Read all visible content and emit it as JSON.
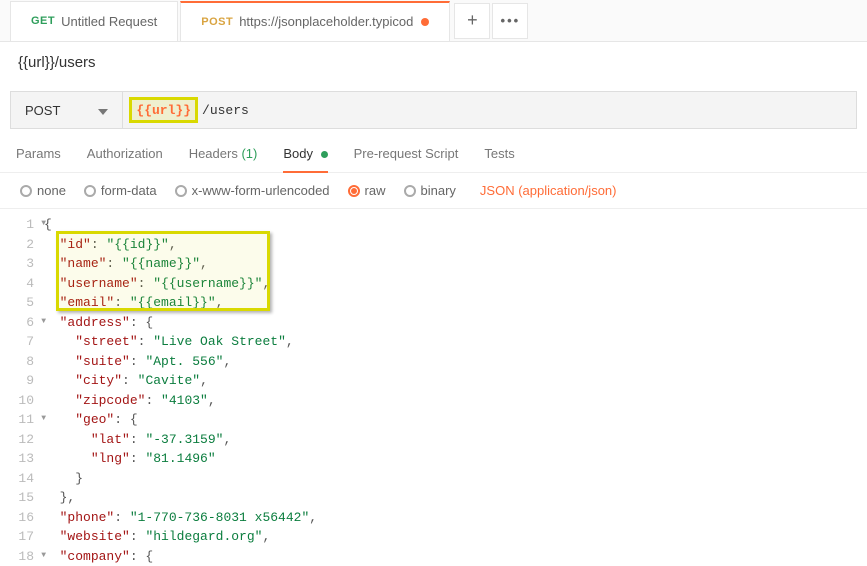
{
  "tabs": [
    {
      "method": "GET",
      "title": "Untitled Request",
      "active": false,
      "dirty": false
    },
    {
      "method": "POST",
      "title": "https://jsonplaceholder.typicod",
      "active": true,
      "dirty": true
    }
  ],
  "request_name": "{{url}}/users",
  "url_bar": {
    "method": "POST",
    "var_token": "{{url}}",
    "path_rest": "/users"
  },
  "sub_tabs": {
    "params": "Params",
    "auth": "Authorization",
    "headers": "Headers",
    "headers_count": "(1)",
    "body": "Body",
    "prerequest": "Pre-request Script",
    "tests": "Tests"
  },
  "body_types": {
    "none": "none",
    "formdata": "form-data",
    "urlenc": "x-www-form-urlencoded",
    "raw": "raw",
    "binary": "binary",
    "content_type": "JSON (application/json)"
  },
  "editor": {
    "lines": [
      {
        "n": 1,
        "fold": true,
        "indent": 0,
        "parts": [
          [
            "pun",
            "{"
          ]
        ]
      },
      {
        "n": 2,
        "fold": false,
        "indent": 1,
        "parts": [
          [
            "key",
            "\"id\""
          ],
          [
            "pun",
            ": "
          ],
          [
            "str",
            "\"{{id}}\""
          ],
          [
            "pun",
            ","
          ]
        ]
      },
      {
        "n": 3,
        "fold": false,
        "indent": 1,
        "parts": [
          [
            "key",
            "\"name\""
          ],
          [
            "pun",
            ": "
          ],
          [
            "str",
            "\"{{name}}\""
          ],
          [
            "pun",
            ","
          ]
        ]
      },
      {
        "n": 4,
        "fold": false,
        "indent": 1,
        "parts": [
          [
            "key",
            "\"username\""
          ],
          [
            "pun",
            ": "
          ],
          [
            "str",
            "\"{{username}}\""
          ],
          [
            "pun",
            ","
          ]
        ]
      },
      {
        "n": 5,
        "fold": false,
        "indent": 1,
        "parts": [
          [
            "key",
            "\"email\""
          ],
          [
            "pun",
            ": "
          ],
          [
            "str",
            "\"{{email}}\""
          ],
          [
            "pun",
            ","
          ]
        ]
      },
      {
        "n": 6,
        "fold": true,
        "indent": 1,
        "parts": [
          [
            "key",
            "\"address\""
          ],
          [
            "pun",
            ": {"
          ]
        ]
      },
      {
        "n": 7,
        "fold": false,
        "indent": 2,
        "parts": [
          [
            "key",
            "\"street\""
          ],
          [
            "pun",
            ": "
          ],
          [
            "str",
            "\"Live Oak Street\""
          ],
          [
            "pun",
            ","
          ]
        ]
      },
      {
        "n": 8,
        "fold": false,
        "indent": 2,
        "parts": [
          [
            "key",
            "\"suite\""
          ],
          [
            "pun",
            ": "
          ],
          [
            "str",
            "\"Apt. 556\""
          ],
          [
            "pun",
            ","
          ]
        ]
      },
      {
        "n": 9,
        "fold": false,
        "indent": 2,
        "parts": [
          [
            "key",
            "\"city\""
          ],
          [
            "pun",
            ": "
          ],
          [
            "str",
            "\"Cavite\""
          ],
          [
            "pun",
            ","
          ]
        ]
      },
      {
        "n": 10,
        "fold": false,
        "indent": 2,
        "parts": [
          [
            "key",
            "\"zipcode\""
          ],
          [
            "pun",
            ": "
          ],
          [
            "str",
            "\"4103\""
          ],
          [
            "pun",
            ","
          ]
        ]
      },
      {
        "n": 11,
        "fold": true,
        "indent": 2,
        "parts": [
          [
            "key",
            "\"geo\""
          ],
          [
            "pun",
            ": {"
          ]
        ]
      },
      {
        "n": 12,
        "fold": false,
        "indent": 3,
        "parts": [
          [
            "key",
            "\"lat\""
          ],
          [
            "pun",
            ": "
          ],
          [
            "str",
            "\"-37.3159\""
          ],
          [
            "pun",
            ","
          ]
        ]
      },
      {
        "n": 13,
        "fold": false,
        "indent": 3,
        "parts": [
          [
            "key",
            "\"lng\""
          ],
          [
            "pun",
            ": "
          ],
          [
            "str",
            "\"81.1496\""
          ]
        ]
      },
      {
        "n": 14,
        "fold": false,
        "indent": 2,
        "parts": [
          [
            "pun",
            "}"
          ]
        ]
      },
      {
        "n": 15,
        "fold": false,
        "indent": 1,
        "parts": [
          [
            "pun",
            "},"
          ]
        ]
      },
      {
        "n": 16,
        "fold": false,
        "indent": 1,
        "parts": [
          [
            "key",
            "\"phone\""
          ],
          [
            "pun",
            ": "
          ],
          [
            "str",
            "\"1-770-736-8031 x56442\""
          ],
          [
            "pun",
            ","
          ]
        ]
      },
      {
        "n": 17,
        "fold": false,
        "indent": 1,
        "parts": [
          [
            "key",
            "\"website\""
          ],
          [
            "pun",
            ": "
          ],
          [
            "str",
            "\"hildegard.org\""
          ],
          [
            "pun",
            ","
          ]
        ]
      },
      {
        "n": 18,
        "fold": true,
        "indent": 1,
        "parts": [
          [
            "key",
            "\"company\""
          ],
          [
            "pun",
            ": {"
          ]
        ]
      }
    ]
  }
}
